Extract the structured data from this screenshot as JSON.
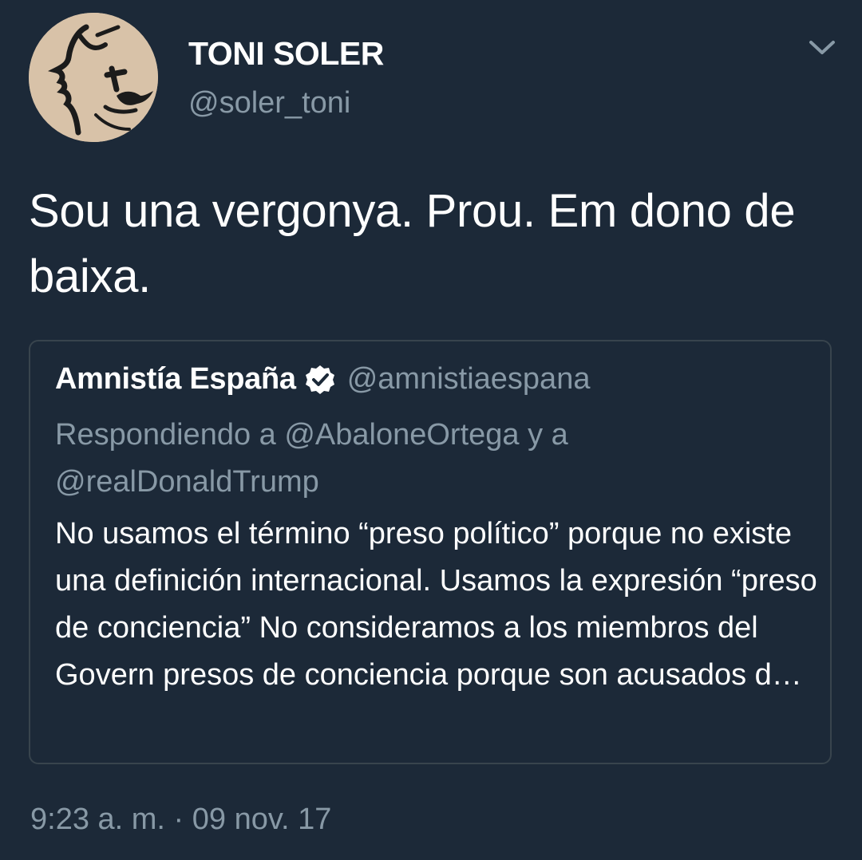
{
  "tweet": {
    "author": {
      "display_name": "TONI SOLER",
      "handle": "@soler_toni"
    },
    "text": "Sou una vergonya. Prou. Em dono de baixa.",
    "timestamp": "9:23 a. m. · 09 nov. 17",
    "menu_icon": "chevron-down-icon"
  },
  "quoted_tweet": {
    "author": {
      "display_name": "Amnistía España",
      "handle": "@amnistiaespana",
      "verified": true,
      "verified_icon": "verified-badge-icon"
    },
    "reply_context": "Respondiendo a @AbaloneOrtega y a @realDonaldTrump",
    "text": "No usamos el término “preso político” porque no existe una definición internacional. Usamos la expresión “preso de conciencia” No consideramos a los miembros del Govern presos de conciencia porque son acusados d…"
  },
  "colors": {
    "background": "#1c2938",
    "primary_text": "#ffffff",
    "secondary_text": "#8899a6",
    "card_border": "#38444d"
  }
}
